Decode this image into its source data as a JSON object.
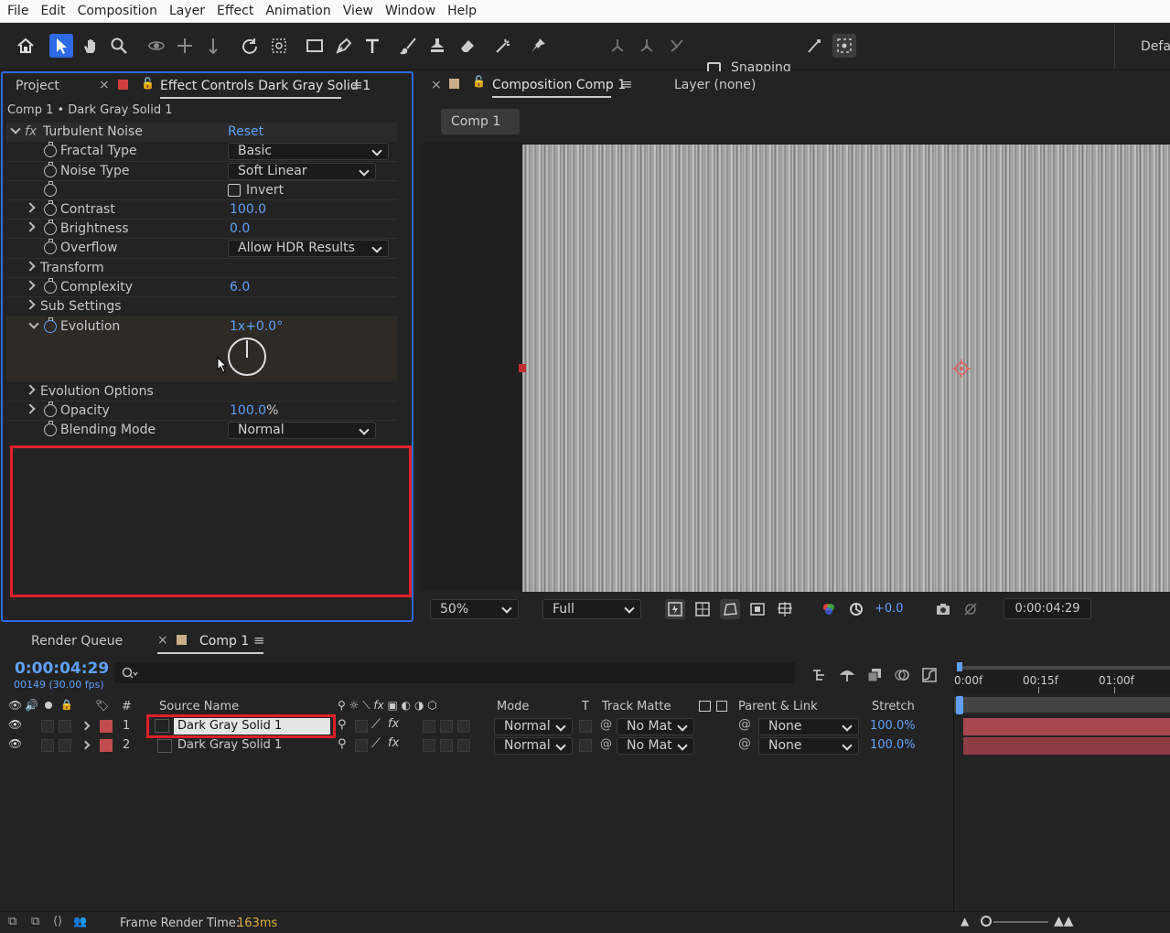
{
  "menu": [
    "File",
    "Edit",
    "Composition",
    "Layer",
    "Effect",
    "Animation",
    "View",
    "Window",
    "Help"
  ],
  "toolbar": {
    "snapping_label": "Snapping",
    "workspace_label": "Defau"
  },
  "project_tab": "Project",
  "effect_controls": {
    "tab": "Effect Controls Dark Gray Solid 1",
    "breadcrumb": "Comp 1 • Dark Gray Solid 1",
    "effect_name": "Turbulent Noise",
    "reset": "Reset",
    "fx": "fx",
    "props": [
      {
        "label": "Fractal Type",
        "value": "Basic"
      },
      {
        "label": "Noise Type",
        "value": "Soft Linear"
      },
      {
        "label": "",
        "value": "Invert"
      },
      {
        "label": "Contrast",
        "value": "100.0"
      },
      {
        "label": "Brightness",
        "value": "0.0"
      },
      {
        "label": "Overflow",
        "value": "Allow HDR Results"
      },
      {
        "label": "Transform",
        "value": ""
      },
      {
        "label": "Complexity",
        "value": "6.0"
      },
      {
        "label": "Sub Settings",
        "value": ""
      },
      {
        "label": "Evolution",
        "value": "1x+0.0°"
      },
      {
        "label": "Evolution Options",
        "value": ""
      },
      {
        "label": "Opacity",
        "value": "100.0",
        "unit": "%"
      },
      {
        "label": "Blending Mode",
        "value": "Normal"
      }
    ]
  },
  "composition": {
    "tab": "Composition Comp 1",
    "layer_tab": "Layer (none)",
    "comp_button": "Comp 1",
    "zoom": "50%",
    "resolution": "Full",
    "exposure": "+0.0",
    "timecode": "0:00:04:29"
  },
  "timeline": {
    "render_queue_tab": "Render Queue",
    "comp_tab": "Comp 1",
    "timecode": "0:00:04:29",
    "frame_info": "00149 (30.00 fps)",
    "search_placeholder": "",
    "headers": {
      "num": "#",
      "source": "Source Name",
      "mode": "Mode",
      "t": "T",
      "track_matte": "Track Matte",
      "parent": "Parent & Link",
      "stretch": "Stretch"
    },
    "ruler": [
      "0:00f",
      "00:15f",
      "01:00f"
    ],
    "layers": [
      {
        "num": "1",
        "name": "Dark Gray Solid 1",
        "mode": "Normal",
        "matte": "No Mat",
        "parent": "None",
        "stretch": "100.0%"
      },
      {
        "num": "2",
        "name": "Dark Gray Solid 1",
        "mode": "Normal",
        "matte": "No Mat",
        "parent": "None",
        "stretch": "100.0%"
      }
    ],
    "status_label": "Frame Render Time:",
    "status_value": "163ms"
  },
  "colors": {
    "accent": "#2d6ae3",
    "value_blue": "#5fa0f5",
    "highlight_red": "#e0202a",
    "layer_label_red": "#c24b4b",
    "bar_red": "#a8474f"
  }
}
